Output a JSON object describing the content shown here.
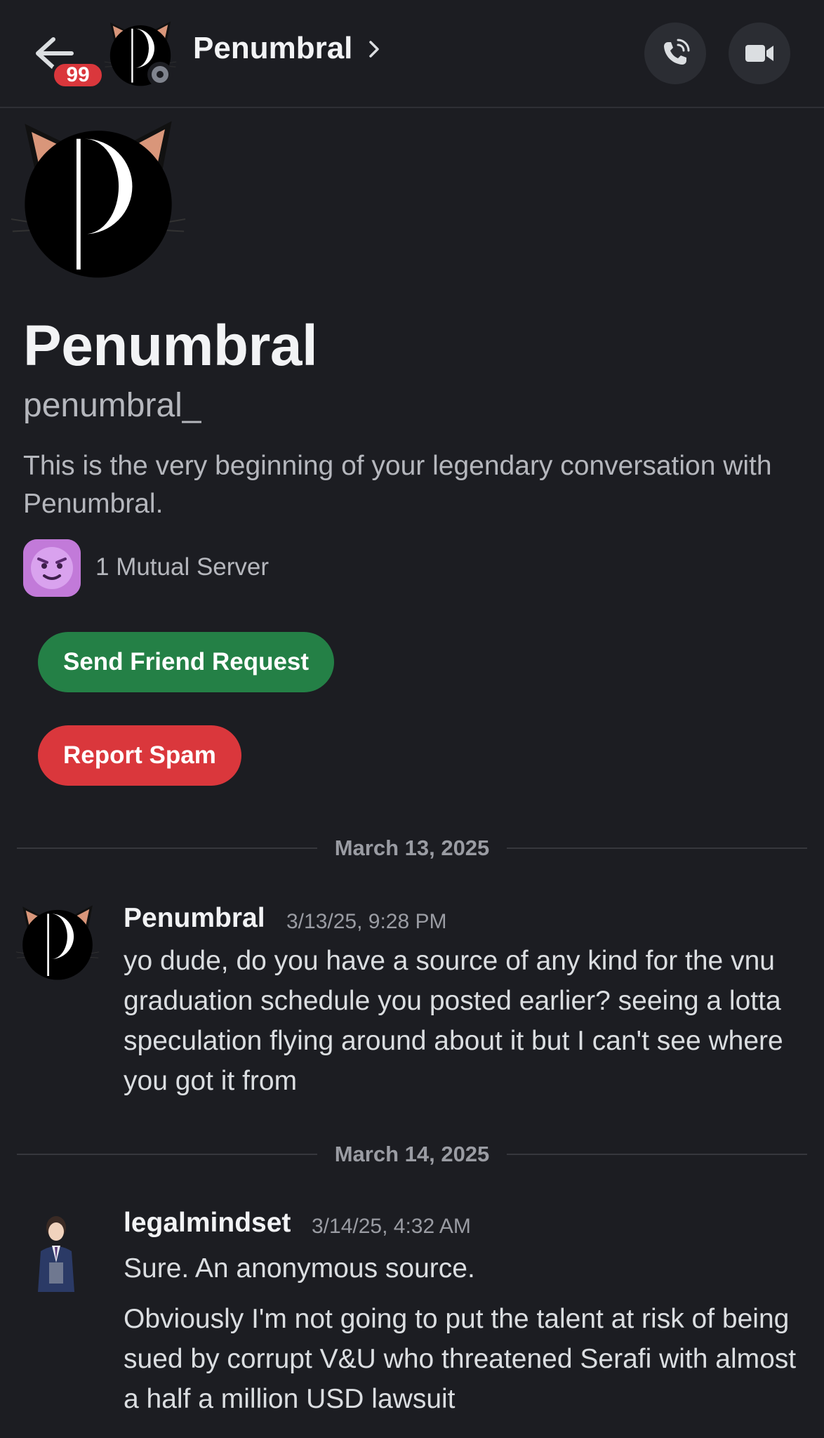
{
  "header": {
    "title": "Penumbral",
    "unread_badge": "99",
    "back_icon": "arrow-left-icon",
    "chevron_icon": "chevron-right-icon",
    "voice_call_icon": "phone-call-icon",
    "video_call_icon": "video-camera-icon"
  },
  "profile": {
    "display_name": "Penumbral",
    "username": "penumbral_",
    "intro": "This is the very beginning of your legendary conversation with Penumbral.",
    "mutual_servers": "1 Mutual Server",
    "send_friend_request_label": "Send Friend Request",
    "report_spam_label": "Report Spam"
  },
  "messages": [
    {
      "date_divider": "March 13, 2025",
      "author": "Penumbral",
      "timestamp": "3/13/25, 9:28 PM",
      "paragraphs": [
        "yo dude, do you have a source of any kind for the vnu graduation schedule you posted earlier? seeing a lotta speculation flying around about it but I can't see where you got it from"
      ]
    },
    {
      "date_divider": "March 14, 2025",
      "author": "legalmindset",
      "timestamp": "3/14/25, 4:32 AM",
      "paragraphs": [
        "Sure. An anonymous source.",
        "Obviously I'm not going to put the talent at risk of being sued by corrupt V&U who threatened Serafi with almost a half a million USD lawsuit"
      ]
    }
  ],
  "colors": {
    "background": "#1c1d22",
    "green_button": "#248046",
    "red_button": "#da373c",
    "badge": "#da373c"
  }
}
